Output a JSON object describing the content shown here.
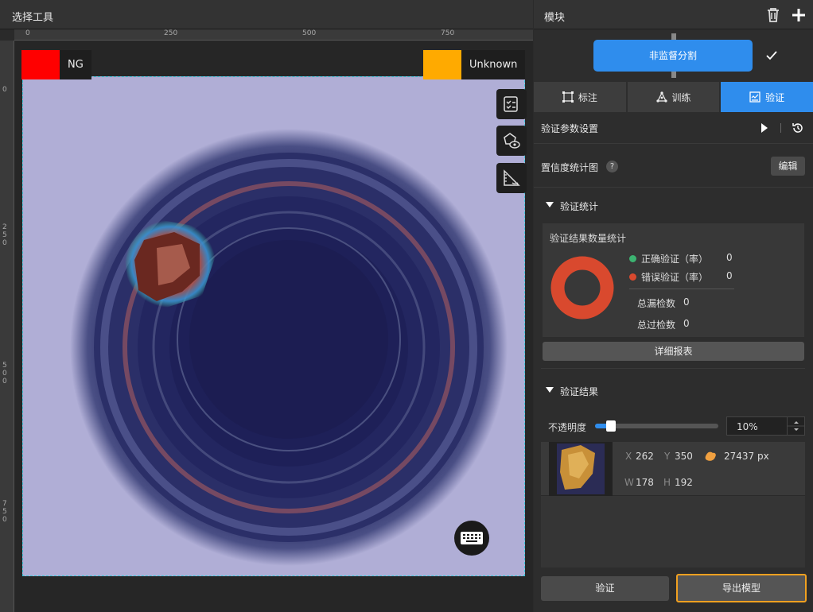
{
  "left_panel": {
    "title": "选择工具",
    "ruler_top_labels": [
      "0",
      "250",
      "500",
      "750"
    ],
    "ruler_left_labels": [
      "0",
      "2\n5\n0",
      "5\n0\n0",
      "7\n5\n0"
    ],
    "tags": {
      "ng_label": "NG",
      "ng_color": "#ff0000",
      "unknown_label": "Unknown",
      "unknown_color": "#ffaa00"
    },
    "tools": [
      "checklist-icon",
      "polygon-eye-icon",
      "ruler-hide-icon",
      "keyboard-icon"
    ]
  },
  "right_panel": {
    "header_title": "模块",
    "module_button": "非监督分割",
    "tabs": [
      {
        "label": "标注",
        "icon": "annotate-icon"
      },
      {
        "label": "训练",
        "icon": "train-icon"
      },
      {
        "label": "验证",
        "icon": "validate-icon"
      }
    ],
    "param_settings": "验证参数设置",
    "confidence_chart": "置信度统计图",
    "edit_button": "编辑",
    "validation_stats": "验证统计",
    "stats_title": "验证结果数量统计",
    "correct_label": "正确验证（率）",
    "correct_value": "0",
    "wrong_label": "错误验证（率）",
    "wrong_value": "0",
    "missed_label": "总漏检数",
    "missed_value": "0",
    "over_label": "总过检数",
    "over_value": "0",
    "detail_button": "详细报表",
    "results_title": "验证结果",
    "opacity_label": "不透明度",
    "opacity_value": "10%",
    "opacity_fraction": 0.1,
    "result": {
      "x_label": "X",
      "x_value": "262",
      "y_label": "Y",
      "y_value": "350",
      "area_value": "27437 px",
      "w_label": "W",
      "w_value": "178",
      "h_label": "H",
      "h_value": "192"
    },
    "validate_button": "验证",
    "export_button": "导出模型",
    "colors": {
      "accent": "#2f8ded",
      "correct": "#3cb371",
      "wrong": "#d9492e",
      "export_border": "#f0a020"
    }
  }
}
